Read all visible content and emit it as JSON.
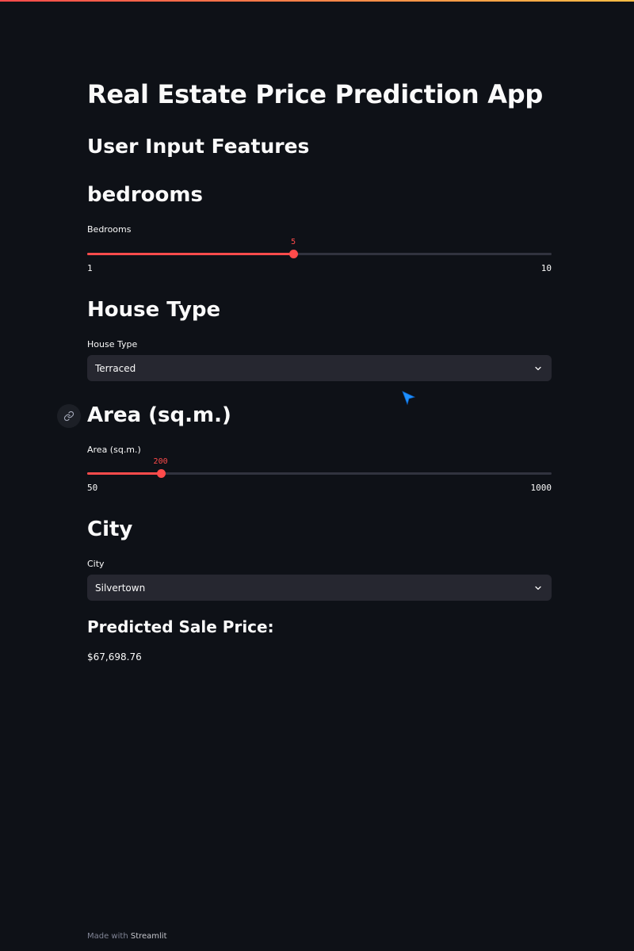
{
  "app": {
    "title": "Real Estate Price Prediction App",
    "accent_color": "#ff4b4b",
    "background_color": "#0e1117"
  },
  "sidebar_header": "User Input Features",
  "bedrooms": {
    "header": "bedrooms",
    "label": "Bedrooms",
    "min": "1",
    "max": "10",
    "value": "5",
    "fraction": 0.444
  },
  "house_type": {
    "header": "House Type",
    "label": "House Type",
    "selected": "Terraced",
    "icon": "chevron-down-icon"
  },
  "area": {
    "header": "Area (sq.m.)",
    "label": "Area (sq.m.)",
    "min": "50",
    "max": "1000",
    "value": "200",
    "fraction": 0.158,
    "anchor_icon": "link-icon"
  },
  "city": {
    "header": "City",
    "label": "City",
    "selected": "Silvertown",
    "icon": "chevron-down-icon"
  },
  "prediction": {
    "header": "Predicted Sale Price:",
    "value": "$67,698.76"
  },
  "footer": {
    "prefix": "Made with",
    "brand": "Streamlit"
  }
}
